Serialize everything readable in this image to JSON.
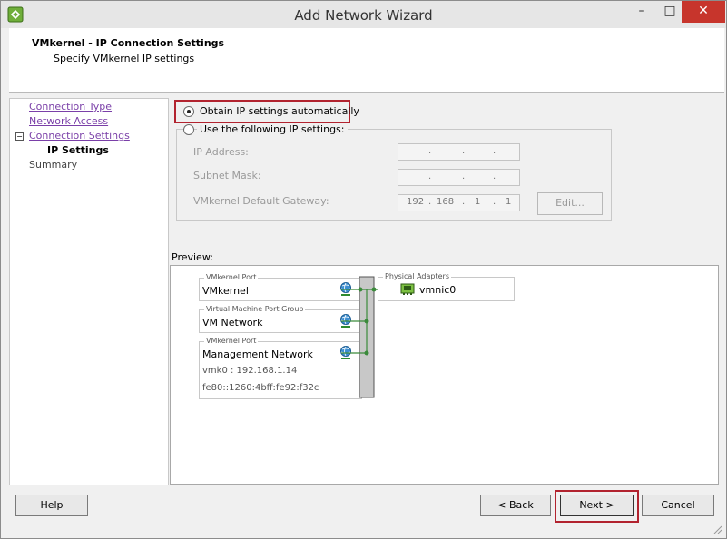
{
  "window": {
    "title": "Add Network Wizard",
    "minimize": "–",
    "maximize": "□",
    "close": "✕"
  },
  "header": {
    "title": "VMkernel - IP Connection Settings",
    "subtitle": "Specify VMkernel IP settings"
  },
  "nav": {
    "items": [
      {
        "label": "Connection Type"
      },
      {
        "label": "Network Access"
      },
      {
        "label": "Connection Settings"
      },
      {
        "label": "IP Settings"
      },
      {
        "label": "Summary"
      }
    ],
    "collapse_glyph": "−"
  },
  "ip_settings": {
    "auto_label": "Obtain IP settings automatically",
    "manual_label": "Use the following IP settings:",
    "selected": "auto",
    "fields": [
      {
        "label": "IP Address:",
        "octets": [
          "",
          "",
          "",
          ""
        ]
      },
      {
        "label": "Subnet Mask:",
        "octets": [
          "",
          "",
          "",
          ""
        ]
      },
      {
        "label": "VMkernel Default Gateway:",
        "octets": [
          "192",
          "168",
          "1",
          "1"
        ]
      }
    ],
    "dot": ".",
    "edit_label": "Edit..."
  },
  "preview": {
    "label": "Preview:",
    "port_groups": [
      {
        "type": "VMkernel Port",
        "name": "VMkernel",
        "details": []
      },
      {
        "type": "Virtual Machine Port Group",
        "name": "VM Network",
        "details": []
      },
      {
        "type": "VMkernel Port",
        "name": "Management Network",
        "details": [
          "vmk0 : 192.168.1.14",
          "fe80::1260:4bff:fe92:f32c"
        ]
      }
    ],
    "physical": {
      "label": "Physical Adapters",
      "adapter": "vmnic0"
    }
  },
  "footer": {
    "help": "Help",
    "back": "< Back",
    "next": "Next >",
    "cancel": "Cancel"
  },
  "colors": {
    "highlight": "#b2232f",
    "link": "#7a3fa8",
    "close": "#c7352c"
  }
}
